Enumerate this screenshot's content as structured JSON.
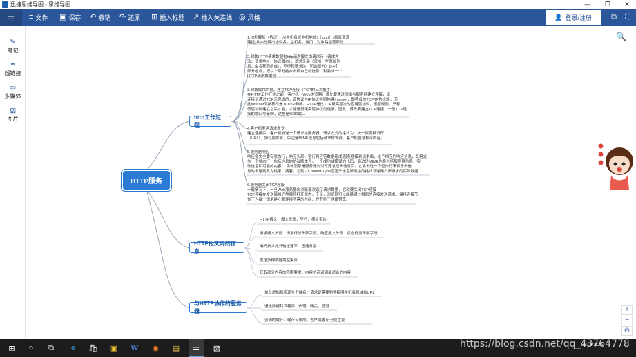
{
  "window": {
    "title": "迅捷思维导图 - 思维导图",
    "minimize": "—",
    "restore": "❐",
    "close": "✕"
  },
  "toolbar": {
    "menu_icon": "☰",
    "file": "文件",
    "save": "保存",
    "undo": "撤销",
    "redo": "还原",
    "insert_title": "插入标题",
    "insert_relation": "插入关连线",
    "style": "风格",
    "login": "登录/注册",
    "icons": {
      "file": "≡",
      "save": "▣",
      "undo": "↶",
      "redo": "↷",
      "insert_title": "⊞",
      "insert_relation": "↗",
      "style": "◎",
      "user": "👤",
      "present": "⧉",
      "fullscreen": "⛶"
    }
  },
  "sidebar": {
    "items": [
      {
        "label": "笔记",
        "icon": "✎"
      },
      {
        "label": "超链接",
        "icon": "⚭"
      },
      {
        "label": "多媒体",
        "icon": "▭"
      },
      {
        "label": "图片",
        "icon": "▨"
      }
    ]
  },
  "mindmap": {
    "root": "HTTP服务",
    "branches": [
      {
        "label": "http工作过程",
        "items": [
          "1.地址解析（协议）：//(主机名或主机地址)（:port）(目录资源\n路径)从中分解出协议名，主机名，端口，对象路径等部分",
          "2.封装HTTP请求数据包http请求报文由请求行（请求方\n法，请求地址，协议版本），请求头部（添加一些附加信\n息，由名称值组成），空行和请求体（可选部分）这4个\n部分组成，把以上部分结合本机自己的信息，封装成一个\nHTTP请求数据包",
          "3.封装成TCP包，建立TCP连接（TCP的三次握手）\n        在HTTP工作开始之前，客户机（Web浏览器）首先要通过网络与服务器建立连接，该\n连接是通过TCP来完成的，该协议与IP协议共同构建Internet，即著名的TCP/IP协议族，因\n此Internet又被称作是TCP/IP网络。HTTP是比TCP更高层次的应用层协议，根据规则，只有\n低层协议建立之后才能，才能进行更高层协议的连接，因此，首先要建立TCP连接，一般TCP连\n接的端口号是80，这里是8080端口",
          "4.客户机发送请求命令\n建立连接后，客户机发送一个请求给服务器，请求方式的格式为：统一资源标识符\n（URL）、协议版本号，后边是MIME信息包括请求修饰符、客户机信息和可内容。",
          "5.服务器响应\n响应报文主要有状态行，响应头部，空行和应答数据组成 服务器接到请求后，给予相应的响应信息，其格式\n为一个状态行，包括信息的协议版本号，一个成功或错误的代码，后边是MIME信息包括服务器信息，实\n体信息和可能的内容。        实体消息是服务器向浏览器发送头信息后，它会发送一个空白行来表示头信\n息的发送到此为结束，接着，它就以Content-Type应答头信息所描述的格式发送用户所请求的实际数据",
          "6.服务器关闭TCP连接\n        一般情况下，一旦Web服务器向浏览器发送了请求数据，它就要关闭TCP连接\nTCP连接在发送后将仍然保持打开状态，于是，浏览器可以继续通过相同的连接发送请求。保持连接节\n省了为每个请求建立新连接所需的时间，还节约了网络带宽。"
        ]
      },
      {
        "label": "HTTP报文内的信息",
        "items": [
          "HTTP报文：报文头部，空行，报文实体",
          "请求报文头部：请求行加头部字段，响应报文头部：状态行加头部字段",
          "编码技术提升输送速率：压缩分割",
          "发送多种数据类型集合",
          "获取部分内容的范围要求，内容协商返回最适合的内容"
        ]
      },
      {
        "label": "与HTTP协作的服务器",
        "items": [
          "单台虚拟机实现多个域名：请求是需要完整指明主机名和域名URL",
          "通信数据转发程序：代理，网关，管道",
          "资源的缓存：缓存有限期，客户端缓存              分支主题"
        ]
      }
    ]
  },
  "canvas_icons": {
    "search": "🔍",
    "zoom_in": "+",
    "zoom_out": "−",
    "fit": "⊙"
  },
  "taskbar": {
    "start": "⊞",
    "search": "○",
    "taskview": "⧉",
    "apps": [
      {
        "name": "edge",
        "icon": "e"
      },
      {
        "name": "store",
        "icon": "🛍"
      },
      {
        "name": "notes",
        "icon": "▣"
      },
      {
        "name": "word",
        "icon": "W"
      },
      {
        "name": "firefox",
        "icon": "◉"
      },
      {
        "name": "explorer",
        "icon": "▤"
      },
      {
        "name": "mindmap",
        "icon": "☰"
      },
      {
        "name": "photos",
        "icon": "▨"
      }
    ],
    "date": "2019/3/25"
  },
  "watermark": "https://blog.csdn.net/qq_43764778"
}
